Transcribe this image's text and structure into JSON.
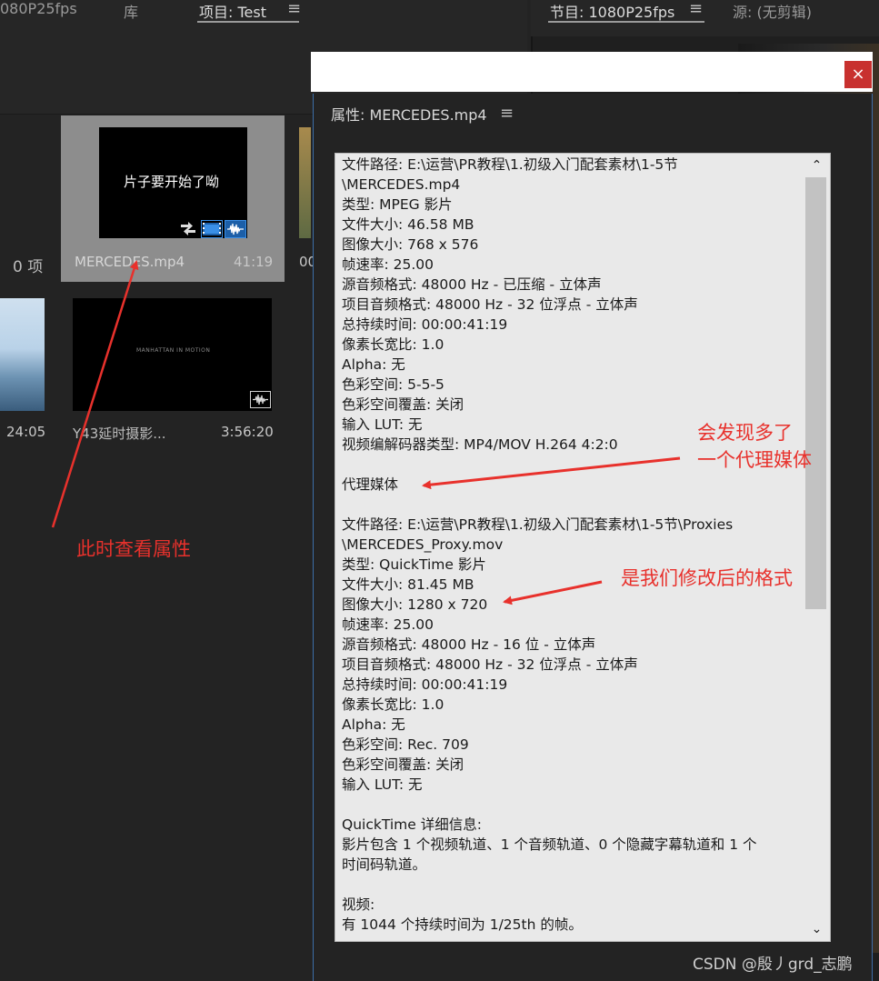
{
  "project_panel": {
    "tabs": [
      {
        "label": "080P25fps"
      },
      {
        "label": "库"
      },
      {
        "label": "项目: Test"
      }
    ],
    "menu_glyph": "≡",
    "item_count": "0 项",
    "clips": [
      {
        "name": "MERCEDES.mp4",
        "duration": "41:19",
        "thumb_text": "片子要开始了呦"
      },
      {
        "name": "Y43延时摄影...",
        "duration": "3:56:20",
        "thumb_text": "MANHATTAN IN MOTION"
      }
    ],
    "partial_labels": {
      "left_duration": "24:05",
      "right_cut": "00"
    }
  },
  "program_panel": {
    "tabs": [
      {
        "label": "节目: 1080P25fps"
      },
      {
        "label": "源: (无剪辑)"
      }
    ],
    "menu_glyph": "≡"
  },
  "properties_dialog": {
    "close_label": "×",
    "title": "属性: MERCEDES.mp4",
    "menu_glyph": "≡",
    "lines": [
      "文件路径: E:\\运营\\PR教程\\1.初级入门配套素材\\1-5节",
      "\\MERCEDES.mp4",
      "类型: MPEG 影片",
      "文件大小: 46.58 MB",
      "图像大小: 768 x 576",
      "帧速率: 25.00",
      "源音频格式: 48000 Hz - 已压缩 - 立体声",
      "项目音频格式: 48000 Hz - 32 位浮点 - 立体声",
      "总持续时间: 00:00:41:19",
      "像素长宽比: 1.0",
      "Alpha: 无",
      "色彩空间: 5-5-5",
      "色彩空间覆盖: 关闭",
      "输入 LUT: 无",
      "视频编解码器类型: MP4/MOV H.264 4:2:0",
      "",
      "代理媒体",
      "",
      "文件路径: E:\\运营\\PR教程\\1.初级入门配套素材\\1-5节\\Proxies",
      "\\MERCEDES_Proxy.mov",
      "类型: QuickTime 影片",
      "文件大小: 81.45 MB",
      "图像大小: 1280 x 720",
      "帧速率: 25.00",
      "源音频格式: 48000 Hz - 16 位 - 立体声",
      "项目音频格式: 48000 Hz - 32 位浮点 - 立体声",
      "总持续时间: 00:00:41:19",
      "像素长宽比: 1.0",
      "Alpha: 无",
      "色彩空间: Rec. 709",
      "色彩空间覆盖: 关闭",
      "输入 LUT: 无",
      "",
      "QuickTime 详细信息:",
      "影片包含 1 个视频轨道、1 个音频轨道、0 个隐藏字幕轨道和 1 个",
      "时间码轨道。",
      "",
      "视频:",
      "有 1044 个持续时间为 1/25th 的帧。"
    ],
    "scroll_up": "⌃",
    "scroll_down": "⌄"
  },
  "annotations": {
    "view_props": "此时查看属性",
    "proxy_line1": "会发现多了",
    "proxy_line2": "一个代理媒体",
    "format": "是我们修改后的格式",
    "color": "#e8312c"
  },
  "watermark": "CSDN @殷丿grd_志鹏"
}
